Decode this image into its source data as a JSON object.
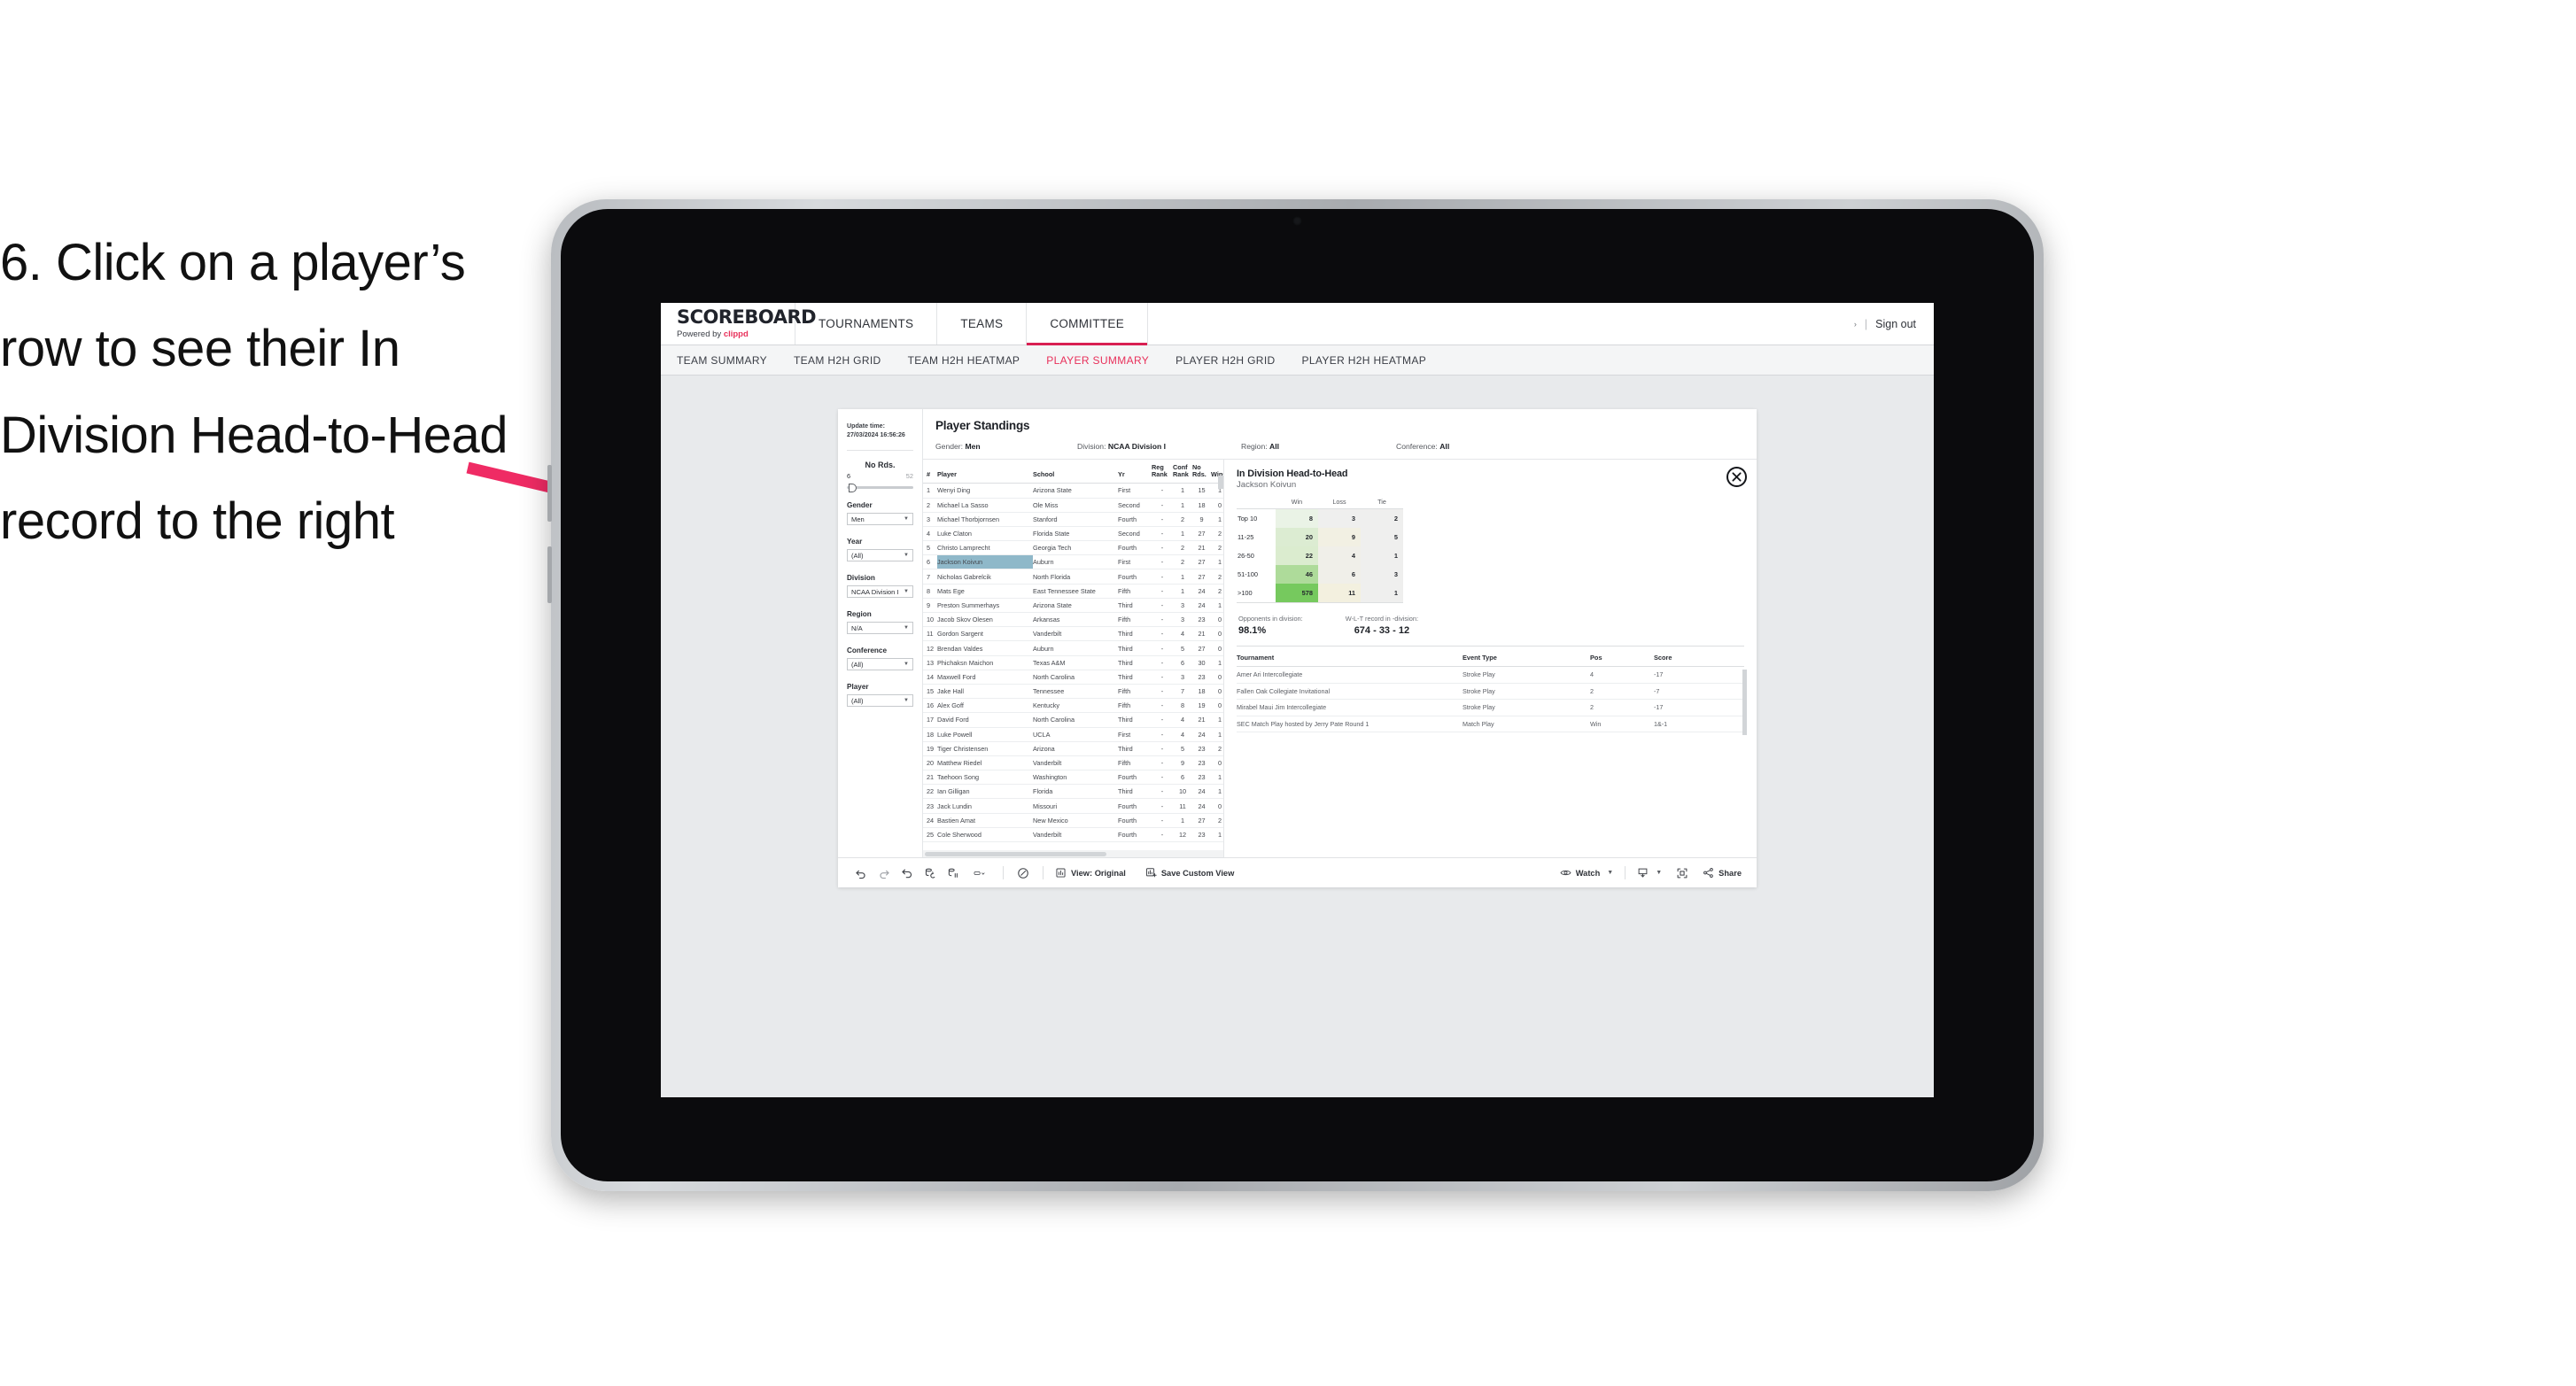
{
  "annotation": {
    "text": "6. Click on a player’s row to see their In Division Head-to-Head record to the right",
    "arrow_color": "#ef2b64"
  },
  "header": {
    "brand_title": "SCOREBOARD",
    "brand_sub_prefix": "Powered by ",
    "brand_sub_name": "clippd",
    "nav": [
      {
        "label": "TOURNAMENTS",
        "active": false
      },
      {
        "label": "TEAMS",
        "active": false
      },
      {
        "label": "COMMITTEE",
        "active": true
      }
    ],
    "account_caret": "›",
    "account_separator": "|",
    "sign_out": "Sign out"
  },
  "subnav": [
    {
      "label": "TEAM SUMMARY",
      "active": false
    },
    {
      "label": "TEAM H2H GRID",
      "active": false
    },
    {
      "label": "TEAM H2H HEATMAP",
      "active": false
    },
    {
      "label": "PLAYER SUMMARY",
      "active": true
    },
    {
      "label": "PLAYER H2H GRID",
      "active": false
    },
    {
      "label": "PLAYER H2H HEATMAP",
      "active": false
    }
  ],
  "filters": {
    "update_label": "Update time:",
    "update_value": "27/03/2024 16:56:26",
    "slider": {
      "title": "No Rds.",
      "min": "6",
      "max": "52"
    },
    "groups": [
      {
        "label": "Gender",
        "value": "Men"
      },
      {
        "label": "Year",
        "value": "(All)"
      },
      {
        "label": "Division",
        "value": "NCAA Division I"
      },
      {
        "label": "Region",
        "value": "N/A"
      },
      {
        "label": "Conference",
        "value": "(All)"
      },
      {
        "label": "Player",
        "value": "(All)"
      }
    ]
  },
  "viz": {
    "title": "Player Standings",
    "summary": [
      {
        "key": "Gender:",
        "value": "Men"
      },
      {
        "key": "Division:",
        "value": "NCAA Division I"
      },
      {
        "key": "Region:",
        "value": "All"
      },
      {
        "key": "Conference:",
        "value": "All"
      }
    ]
  },
  "standings": {
    "columns": [
      "#",
      "Player",
      "School",
      "Yr",
      "Reg Rank",
      "Conf Rank",
      "No Rds.",
      "Wins"
    ],
    "selected_row": 6,
    "rows": [
      {
        "n": "1",
        "player": "Wenyi Ding",
        "school": "Arizona State",
        "yr": "First",
        "reg": "-",
        "conf": "1",
        "rds": "15",
        "wins": "1"
      },
      {
        "n": "2",
        "player": "Michael La Sasso",
        "school": "Ole Miss",
        "yr": "Second",
        "reg": "-",
        "conf": "1",
        "rds": "18",
        "wins": "0"
      },
      {
        "n": "3",
        "player": "Michael Thorbjornsen",
        "school": "Stanford",
        "yr": "Fourth",
        "reg": "-",
        "conf": "2",
        "rds": "9",
        "wins": "1"
      },
      {
        "n": "4",
        "player": "Luke Claton",
        "school": "Florida State",
        "yr": "Second",
        "reg": "-",
        "conf": "1",
        "rds": "27",
        "wins": "2"
      },
      {
        "n": "5",
        "player": "Christo Lamprecht",
        "school": "Georgia Tech",
        "yr": "Fourth",
        "reg": "-",
        "conf": "2",
        "rds": "21",
        "wins": "2"
      },
      {
        "n": "6",
        "player": "Jackson Koivun",
        "school": "Auburn",
        "yr": "First",
        "reg": "-",
        "conf": "2",
        "rds": "27",
        "wins": "1"
      },
      {
        "n": "7",
        "player": "Nicholas Gabrelcik",
        "school": "North Florida",
        "yr": "Fourth",
        "reg": "-",
        "conf": "1",
        "rds": "27",
        "wins": "2"
      },
      {
        "n": "8",
        "player": "Mats Ege",
        "school": "East Tennessee State",
        "yr": "Fifth",
        "reg": "-",
        "conf": "1",
        "rds": "24",
        "wins": "2"
      },
      {
        "n": "9",
        "player": "Preston Summerhays",
        "school": "Arizona State",
        "yr": "Third",
        "reg": "-",
        "conf": "3",
        "rds": "24",
        "wins": "1"
      },
      {
        "n": "10",
        "player": "Jacob Skov Olesen",
        "school": "Arkansas",
        "yr": "Fifth",
        "reg": "-",
        "conf": "3",
        "rds": "23",
        "wins": "0"
      },
      {
        "n": "11",
        "player": "Gordon Sargent",
        "school": "Vanderbilt",
        "yr": "Third",
        "reg": "-",
        "conf": "4",
        "rds": "21",
        "wins": "0"
      },
      {
        "n": "12",
        "player": "Brendan Valdes",
        "school": "Auburn",
        "yr": "Third",
        "reg": "-",
        "conf": "5",
        "rds": "27",
        "wins": "0"
      },
      {
        "n": "13",
        "player": "Phichaksn Maichon",
        "school": "Texas A&M",
        "yr": "Third",
        "reg": "-",
        "conf": "6",
        "rds": "30",
        "wins": "1"
      },
      {
        "n": "14",
        "player": "Maxwell Ford",
        "school": "North Carolina",
        "yr": "Third",
        "reg": "-",
        "conf": "3",
        "rds": "23",
        "wins": "0"
      },
      {
        "n": "15",
        "player": "Jake Hall",
        "school": "Tennessee",
        "yr": "Fifth",
        "reg": "-",
        "conf": "7",
        "rds": "18",
        "wins": "0"
      },
      {
        "n": "16",
        "player": "Alex Goff",
        "school": "Kentucky",
        "yr": "Fifth",
        "reg": "-",
        "conf": "8",
        "rds": "19",
        "wins": "0"
      },
      {
        "n": "17",
        "player": "David Ford",
        "school": "North Carolina",
        "yr": "Third",
        "reg": "-",
        "conf": "4",
        "rds": "21",
        "wins": "1"
      },
      {
        "n": "18",
        "player": "Luke Powell",
        "school": "UCLA",
        "yr": "First",
        "reg": "-",
        "conf": "4",
        "rds": "24",
        "wins": "1"
      },
      {
        "n": "19",
        "player": "Tiger Christensen",
        "school": "Arizona",
        "yr": "Third",
        "reg": "-",
        "conf": "5",
        "rds": "23",
        "wins": "2"
      },
      {
        "n": "20",
        "player": "Matthew Riedel",
        "school": "Vanderbilt",
        "yr": "Fifth",
        "reg": "-",
        "conf": "9",
        "rds": "23",
        "wins": "0"
      },
      {
        "n": "21",
        "player": "Taehoon Song",
        "school": "Washington",
        "yr": "Fourth",
        "reg": "-",
        "conf": "6",
        "rds": "23",
        "wins": "1"
      },
      {
        "n": "22",
        "player": "Ian Gilligan",
        "school": "Florida",
        "yr": "Third",
        "reg": "-",
        "conf": "10",
        "rds": "24",
        "wins": "1"
      },
      {
        "n": "23",
        "player": "Jack Lundin",
        "school": "Missouri",
        "yr": "Fourth",
        "reg": "-",
        "conf": "11",
        "rds": "24",
        "wins": "0"
      },
      {
        "n": "24",
        "player": "Bastien Amat",
        "school": "New Mexico",
        "yr": "Fourth",
        "reg": "-",
        "conf": "1",
        "rds": "27",
        "wins": "2"
      },
      {
        "n": "25",
        "player": "Cole Sherwood",
        "school": "Vanderbilt",
        "yr": "Fourth",
        "reg": "-",
        "conf": "12",
        "rds": "23",
        "wins": "1"
      }
    ]
  },
  "h2h": {
    "title": "In Division Head-to-Head",
    "player": "Jackson Koivun",
    "close_icon": "close-circle-icon",
    "chart_data": {
      "type": "heatmap",
      "title": "In Division Head-to-Head",
      "subtitle": "Jackson Koivun",
      "columns": [
        "Win",
        "Loss",
        "Tie"
      ],
      "rows": [
        "Top 10",
        "11-25",
        "26-50",
        "51-100",
        ">100"
      ],
      "values": [
        [
          8,
          3,
          2
        ],
        [
          20,
          9,
          5
        ],
        [
          22,
          4,
          1
        ],
        [
          46,
          6,
          3
        ],
        [
          578,
          11,
          1
        ]
      ],
      "cell_colors": [
        [
          "#eaf3e6",
          "#efefee",
          "#efefee"
        ],
        [
          "#dcecd2",
          "#f2f0e3",
          "#efefee"
        ],
        [
          "#dbeccf",
          "#f0efe9",
          "#efefee"
        ],
        [
          "#aedb9a",
          "#f0efe9",
          "#efefee"
        ],
        [
          "#76c95e",
          "#f3f0df",
          "#efefee"
        ]
      ],
      "colorscale": "green-sequential"
    },
    "stats": [
      {
        "key": "Opponents in division:",
        "value": "98.1%"
      },
      {
        "key": "W-L-T record in -division:",
        "value": "674 - 33 - 12"
      }
    ],
    "tournament_columns": [
      "Tournament",
      "Event Type",
      "Pos",
      "Score"
    ],
    "tournaments": [
      {
        "name": "Amer Ari Intercollegiate",
        "type": "Stroke Play",
        "pos": "4",
        "score": "-17"
      },
      {
        "name": "Fallen Oak Collegiate Invitational",
        "type": "Stroke Play",
        "pos": "2",
        "score": "-7"
      },
      {
        "name": "Mirabel Maui Jim Intercollegiate",
        "type": "Stroke Play",
        "pos": "2",
        "score": "-17"
      },
      {
        "name": "SEC Match Play hosted by Jerry Pate Round 1",
        "type": "Match Play",
        "pos": "Win",
        "score": "1&-1"
      }
    ]
  },
  "toolbar": {
    "icons": [
      "undo-icon",
      "redo-icon",
      "revert-icon",
      "refresh-data-icon",
      "pause-updates-icon",
      "data-source-icon"
    ],
    "view_label": "View: Original",
    "save_label": "Save Custom View",
    "watch_label": "Watch",
    "share_label": "Share",
    "download_icon": "download-icon",
    "fullscreen_icon": "fullscreen-icon",
    "share_icon": "share-icon",
    "eye_icon": "eye-icon",
    "history_icon": "history-icon"
  }
}
